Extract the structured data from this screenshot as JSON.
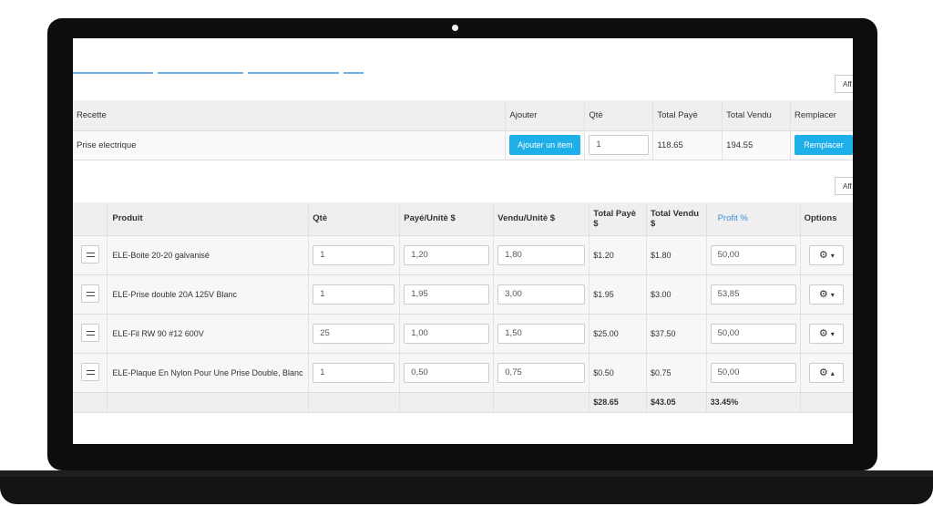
{
  "recipe_table": {
    "headers": [
      "Recette",
      "Ajouter",
      "Qtè",
      "Total Payè",
      "Total Vendu",
      "Remplacer"
    ],
    "row": {
      "name": "Prise electrique",
      "add_button": "Ajouter un item",
      "qty": "1",
      "total_paid": "118.65",
      "total_sold": "194.55",
      "replace_button": "Remplacer"
    }
  },
  "aff_label": "Aff",
  "products_table": {
    "headers": [
      "Produit",
      "Qtè",
      "Payé/Unitè $",
      "Vendu/Unitè $",
      "Total Payè $",
      "Total Vendu $",
      "Profit %",
      "Options"
    ],
    "rows": [
      {
        "product": "ELE-Boite 20-20 galvanisé",
        "qty": "1",
        "paid_unit": "1,20",
        "sold_unit": "1,80",
        "total_paid": "$1.20",
        "total_sold": "$1.80",
        "profit": "50,00",
        "options_icon": "gear-icon",
        "caret": "▾"
      },
      {
        "product": "ELE-Prise double 20A 125V Blanc",
        "qty": "1",
        "paid_unit": "1,95",
        "sold_unit": "3,00",
        "total_paid": "$1.95",
        "total_sold": "$3.00",
        "profit": "53,85",
        "options_icon": "gear-icon",
        "caret": "▾"
      },
      {
        "product": "ELE-Fil RW 90 #12 600V",
        "qty": "25",
        "paid_unit": "1,00",
        "sold_unit": "1,50",
        "total_paid": "$25.00",
        "total_sold": "$37.50",
        "profit": "50,00",
        "options_icon": "gear-icon",
        "caret": "▾"
      },
      {
        "product": "ELE-Plaque En Nylon Pour Une Prise Double, Blanc",
        "qty": "1",
        "paid_unit": "0,50",
        "sold_unit": "0,75",
        "total_paid": "$0.50",
        "total_sold": "$0.75",
        "profit": "50,00",
        "options_icon": "gear-icon",
        "caret": "▴"
      }
    ],
    "totals": {
      "total_paid": "$28.65",
      "total_sold": "$43.05",
      "profit": "33.45%"
    }
  },
  "colors": {
    "accent": "#1eaee8",
    "tab_underline": "#6fb0e8",
    "header_bg": "#efefef"
  }
}
